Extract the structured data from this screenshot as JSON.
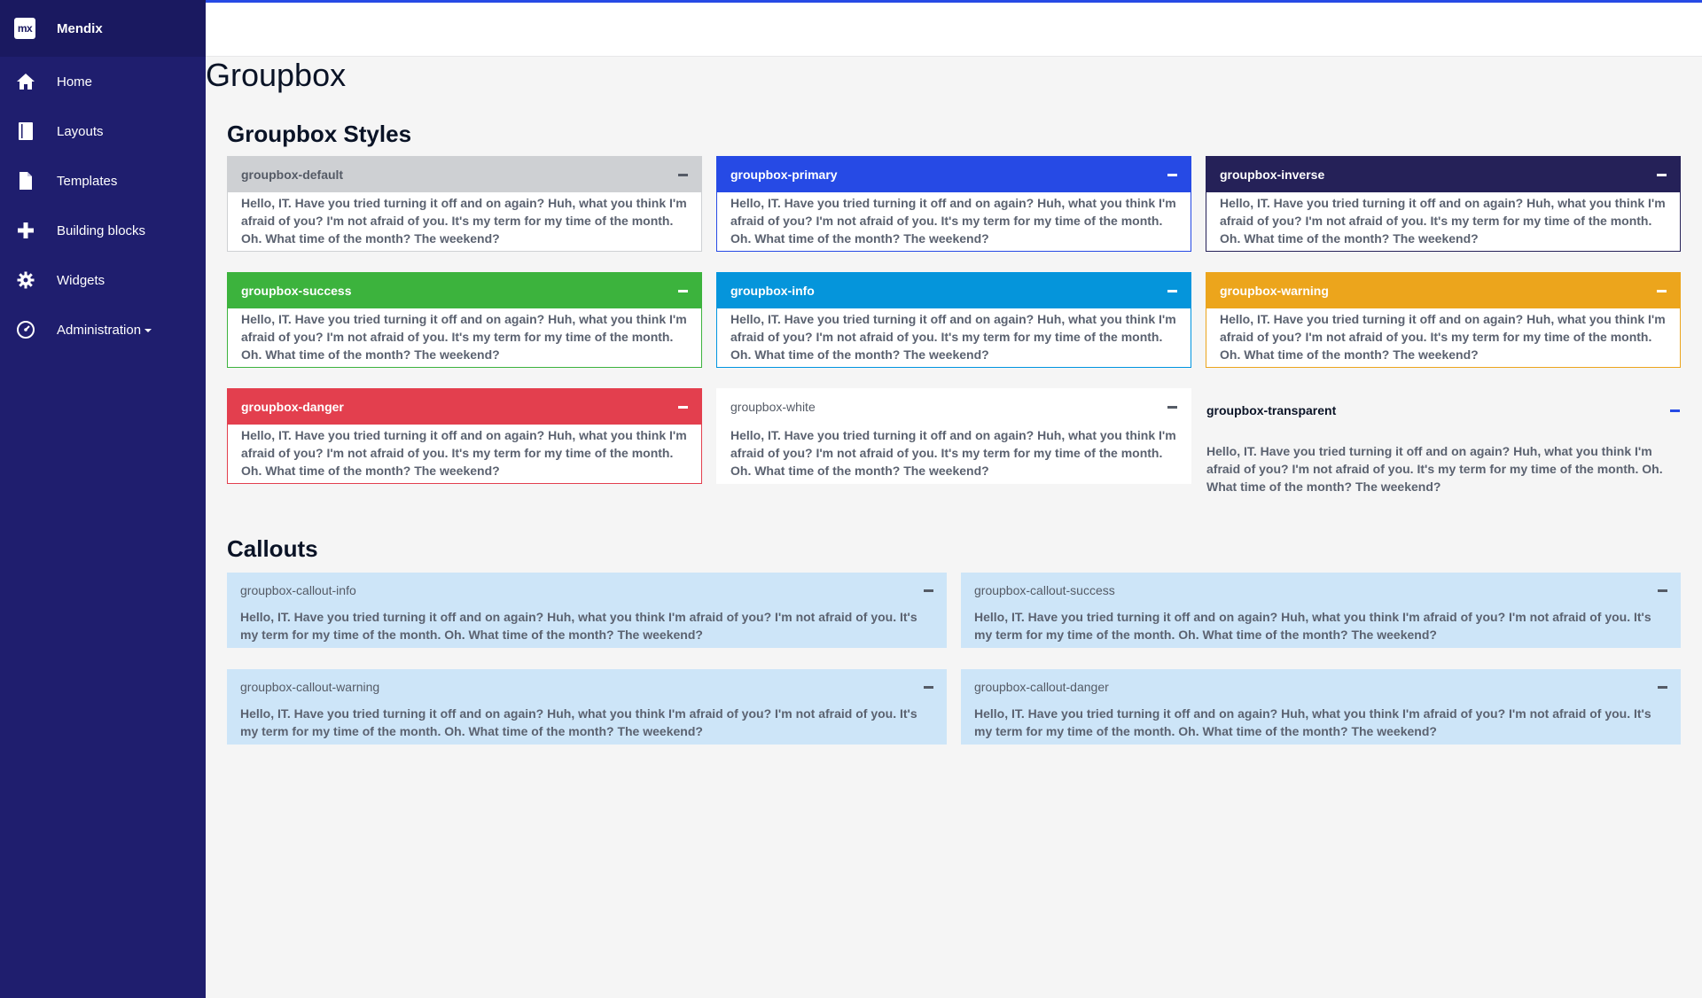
{
  "brand": {
    "logo": "mx",
    "name": "Mendix"
  },
  "nav": [
    {
      "label": "Home",
      "icon": "home-icon"
    },
    {
      "label": "Layouts",
      "icon": "book-icon"
    },
    {
      "label": "Templates",
      "icon": "file-icon"
    },
    {
      "label": "Building blocks",
      "icon": "plus-icon"
    },
    {
      "label": "Widgets",
      "icon": "gear-icon"
    },
    {
      "label": "Administration",
      "icon": "dashboard-icon"
    }
  ],
  "page": {
    "title": "Groupbox"
  },
  "sections": {
    "styles": "Groupbox Styles",
    "callouts": "Callouts"
  },
  "sample_text": "Hello, IT. Have you tried turning it off and on again? Huh, what you think I'm afraid of you? I'm not afraid of you. It's my term for my time of the month. Oh. What time of the month? The weekend?",
  "groupboxes": [
    {
      "name": "groupbox-default"
    },
    {
      "name": "groupbox-primary"
    },
    {
      "name": "groupbox-inverse"
    },
    {
      "name": "groupbox-success"
    },
    {
      "name": "groupbox-info"
    },
    {
      "name": "groupbox-warning"
    },
    {
      "name": "groupbox-danger"
    },
    {
      "name": "groupbox-white"
    },
    {
      "name": "groupbox-transparent"
    }
  ],
  "callouts": [
    {
      "name": "groupbox-callout-info"
    },
    {
      "name": "groupbox-callout-success"
    },
    {
      "name": "groupbox-callout-warning"
    },
    {
      "name": "groupbox-callout-danger"
    }
  ],
  "colors": {
    "sidebar": "#1f1e6e",
    "primary": "#264ae5",
    "inverse": "#252158",
    "success": "#3cb33d",
    "info": "#0595db",
    "warning": "#eca51c",
    "danger": "#e33f4e",
    "callout": "#cde5f8"
  }
}
